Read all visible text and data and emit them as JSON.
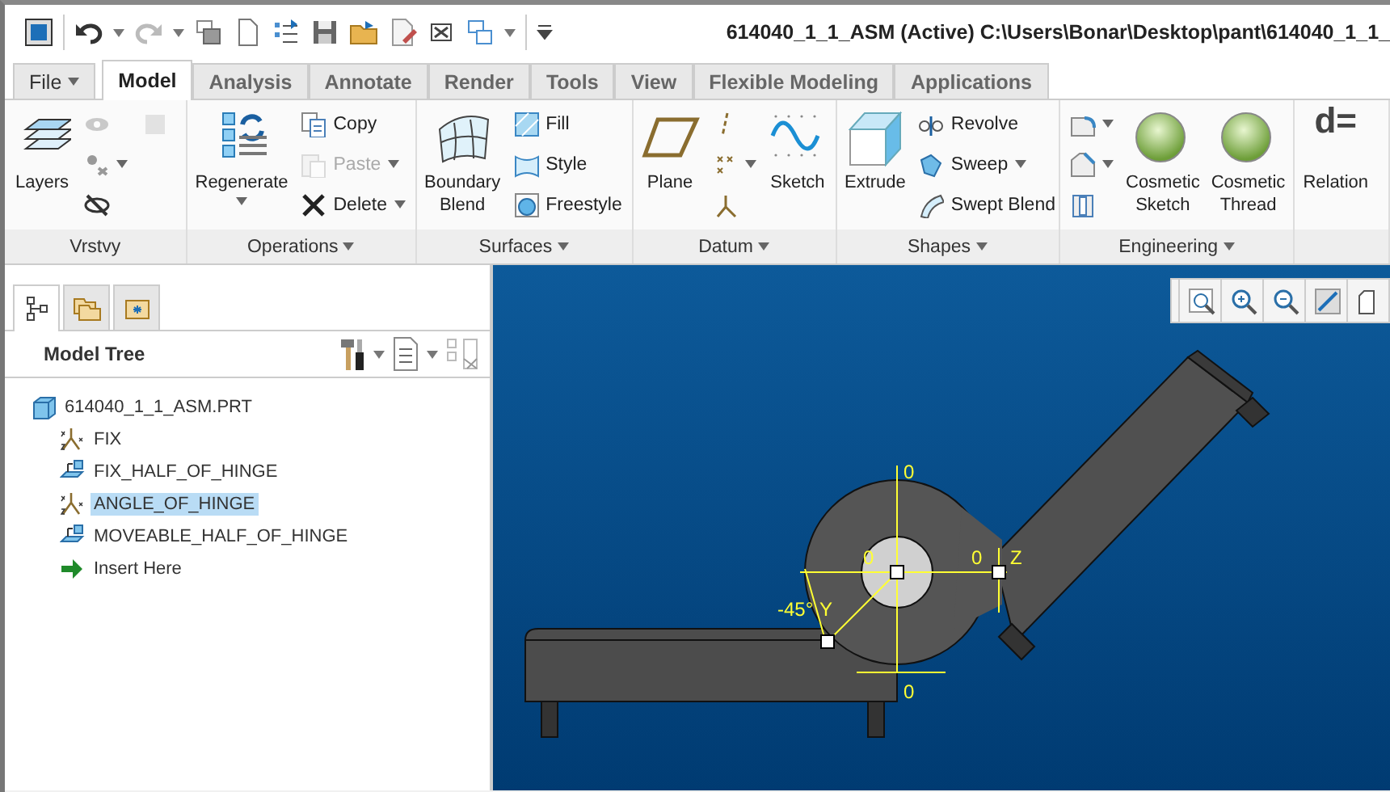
{
  "window": {
    "title": "614040_1_1_ASM (Active) C:\\Users\\Bonar\\Desktop\\pant\\614040_1_1_"
  },
  "tabs": [
    {
      "label": "File",
      "kind": "menu",
      "selected": false
    },
    {
      "label": "Model",
      "kind": "tab",
      "selected": true
    },
    {
      "label": "Analysis",
      "kind": "tab",
      "selected": false
    },
    {
      "label": "Annotate",
      "kind": "tab",
      "selected": false
    },
    {
      "label": "Render",
      "kind": "tab",
      "selected": false
    },
    {
      "label": "Tools",
      "kind": "tab",
      "selected": false
    },
    {
      "label": "View",
      "kind": "tab",
      "selected": false
    },
    {
      "label": "Flexible Modeling",
      "kind": "tab",
      "selected": false
    },
    {
      "label": "Applications",
      "kind": "tab",
      "selected": false
    }
  ],
  "ribbon": {
    "groups": [
      {
        "label": "Vrstvy",
        "dropdown": false,
        "items": [
          {
            "kind": "large",
            "label": "Layers",
            "dropdown": false,
            "disabled": false
          },
          {
            "kind": "icon",
            "dropdown": false,
            "disabled": true
          },
          {
            "kind": "icon",
            "dropdown": true,
            "disabled": false
          },
          {
            "kind": "icon",
            "dropdown": false,
            "disabled": false
          },
          {
            "kind": "icon",
            "dropdown": false,
            "disabled": true
          }
        ]
      },
      {
        "label": "Operations",
        "dropdown": true,
        "items": [
          {
            "kind": "large",
            "label": "Regenerate",
            "dropdown": true,
            "disabled": false
          },
          {
            "kind": "small",
            "label": "Copy",
            "dropdown": false,
            "disabled": false
          },
          {
            "kind": "small",
            "label": "Paste",
            "dropdown": true,
            "disabled": true
          },
          {
            "kind": "small",
            "label": "Delete",
            "dropdown": true,
            "disabled": false
          }
        ]
      },
      {
        "label": "Surfaces",
        "dropdown": true,
        "items": [
          {
            "kind": "large",
            "label": "Boundary Blend",
            "dropdown": false,
            "disabled": false
          },
          {
            "kind": "small",
            "label": "Fill",
            "dropdown": false,
            "disabled": false
          },
          {
            "kind": "small",
            "label": "Style",
            "dropdown": false,
            "disabled": false
          },
          {
            "kind": "small",
            "label": "Freestyle",
            "dropdown": false,
            "disabled": false
          }
        ]
      },
      {
        "label": "Datum",
        "dropdown": true,
        "items": [
          {
            "kind": "large",
            "label": "Plane",
            "dropdown": false,
            "disabled": false
          },
          {
            "kind": "icon",
            "dropdown": false,
            "disabled": false
          },
          {
            "kind": "icon",
            "dropdown": true,
            "disabled": false
          },
          {
            "kind": "icon",
            "dropdown": false,
            "disabled": false
          },
          {
            "kind": "large",
            "label": "Sketch",
            "dropdown": false,
            "disabled": false
          }
        ]
      },
      {
        "label": "Shapes",
        "dropdown": true,
        "items": [
          {
            "kind": "large",
            "label": "Extrude",
            "dropdown": false,
            "disabled": false
          },
          {
            "kind": "small",
            "label": "Revolve",
            "dropdown": false,
            "disabled": false
          },
          {
            "kind": "small",
            "label": "Sweep",
            "dropdown": true,
            "disabled": false
          },
          {
            "kind": "small",
            "label": "Swept Blend",
            "dropdown": false,
            "disabled": false
          }
        ]
      },
      {
        "label": "Engineering",
        "dropdown": true,
        "items": [
          {
            "kind": "icon",
            "dropdown": true,
            "disabled": false
          },
          {
            "kind": "icon",
            "dropdown": true,
            "disabled": false
          },
          {
            "kind": "icon",
            "dropdown": false,
            "disabled": false
          },
          {
            "kind": "large",
            "label": "Cosmetic Sketch",
            "dropdown": false,
            "disabled": false
          },
          {
            "kind": "large",
            "label": "Cosmetic Thread",
            "dropdown": false,
            "disabled": false
          }
        ]
      },
      {
        "items": [
          {
            "kind": "large",
            "label": "Relation",
            "glyph": "d=",
            "dropdown": false,
            "disabled": false
          }
        ]
      }
    ]
  },
  "navigator": {
    "tabs": [
      {
        "selected": true
      },
      {
        "selected": false
      },
      {
        "selected": false
      }
    ],
    "title": "Model Tree",
    "tree": {
      "label": "614040_1_1_ASM.PRT",
      "kind": "part",
      "selected": false,
      "children": [
        {
          "label": "FIX",
          "kind": "csys",
          "selected": false
        },
        {
          "label": "FIX_HALF_OF_HINGE",
          "kind": "component",
          "selected": false
        },
        {
          "label": "ANGLE_OF_HINGE",
          "kind": "csys",
          "selected": true
        },
        {
          "label": "MOVEABLE_HALF_OF_HINGE",
          "kind": "component",
          "selected": false
        },
        {
          "label": "Insert Here",
          "kind": "insert",
          "selected": false
        }
      ]
    }
  },
  "viewport": {
    "dimension_labels": [
      "0",
      "0",
      "0",
      "Z",
      "-45°",
      "Y",
      "0"
    ]
  }
}
